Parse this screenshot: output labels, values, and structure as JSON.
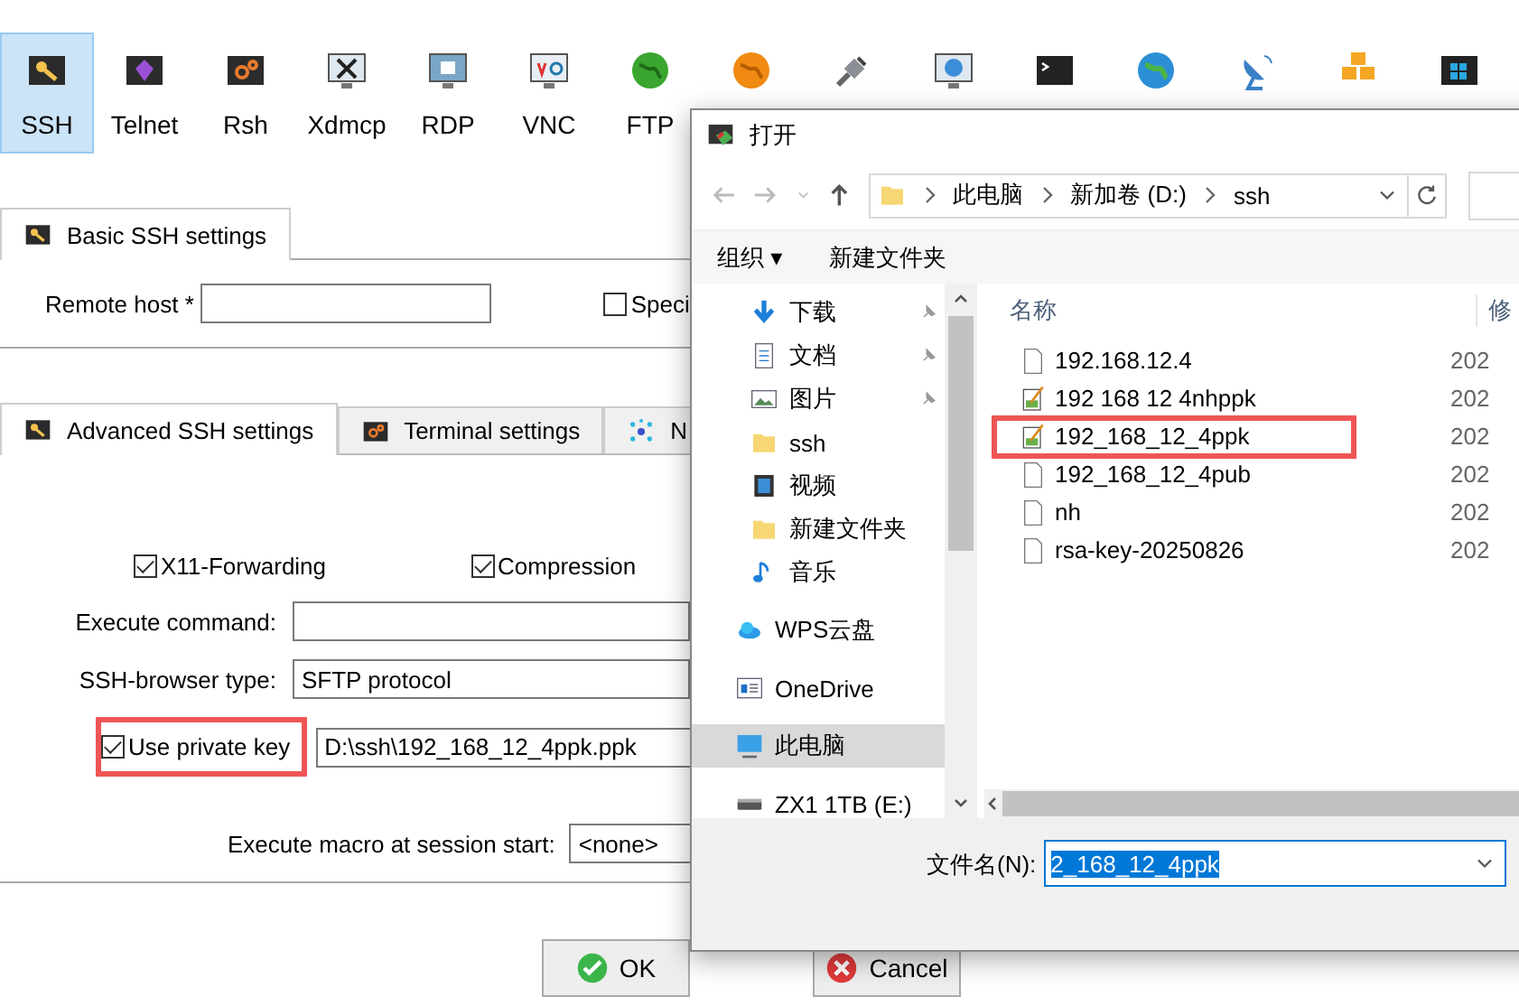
{
  "toolbar": [
    {
      "kind": "key",
      "label": "SSH",
      "selected": true
    },
    {
      "kind": "gem",
      "label": "Telnet",
      "selected": false
    },
    {
      "kind": "gears",
      "label": "Rsh",
      "selected": false
    },
    {
      "kind": "xwin",
      "label": "Xdmcp",
      "selected": false
    },
    {
      "kind": "rdp",
      "label": "RDP",
      "selected": false
    },
    {
      "kind": "vnc",
      "label": "VNC",
      "selected": false
    },
    {
      "kind": "globe-green",
      "label": "FTP",
      "selected": false
    },
    {
      "kind": "globe-orange",
      "selected": false
    },
    {
      "kind": "plug",
      "selected": false
    },
    {
      "kind": "monitor-globe",
      "selected": false
    },
    {
      "kind": "terminal",
      "selected": false
    },
    {
      "kind": "globe-blue",
      "selected": false
    },
    {
      "kind": "dish",
      "selected": false
    },
    {
      "kind": "cubes",
      "selected": false
    },
    {
      "kind": "windows",
      "selected": false
    }
  ],
  "basic_tab": {
    "label": "Basic SSH settings",
    "selected": true
  },
  "remote_host": {
    "label": "Remote host *"
  },
  "specify_checkbox": {
    "label": "Speci",
    "checked": false
  },
  "advanced_tabs": [
    {
      "kind": "key",
      "label": "Advanced SSH settings",
      "selected": true
    },
    {
      "kind": "gears",
      "label": "Terminal settings",
      "selected": false
    },
    {
      "kind": "network",
      "label": "N",
      "selected": false
    }
  ],
  "x11_forwarding": {
    "label": "X11-Forwarding",
    "checked": true
  },
  "compression": {
    "label": "Compression",
    "checked": true
  },
  "execute_command": {
    "label": "Execute command:"
  },
  "ssh_browser_type": {
    "label": "SSH-browser type:",
    "value": "SFTP protocol"
  },
  "use_private_key": {
    "label": "Use private key",
    "checked": true,
    "highlighted": true,
    "value": "D:\\ssh\\192_168_12_4ppk.ppk"
  },
  "execute_macro": {
    "label": "Execute macro at session start:",
    "value": "<none>"
  },
  "buttons": [
    {
      "kind": "ok",
      "label": "OK"
    },
    {
      "kind": "cancel",
      "label": "Cancel"
    }
  ],
  "dialog": {
    "title": "打开",
    "path": [
      "此电脑",
      "新加卷 (D:)",
      "ssh"
    ],
    "toolbar": [
      "组织 ▾",
      "新建文件夹"
    ],
    "quick_access": [
      {
        "kind": "download",
        "label": "下载",
        "pinned": true
      },
      {
        "kind": "document",
        "label": "文档",
        "pinned": true
      },
      {
        "kind": "picture",
        "label": "图片",
        "pinned": true
      },
      {
        "kind": "folder",
        "label": "ssh",
        "pinned": false
      },
      {
        "kind": "video",
        "label": "视频",
        "pinned": false
      },
      {
        "kind": "folder",
        "label": "新建文件夹",
        "pinned": false
      },
      {
        "kind": "music",
        "label": "音乐",
        "pinned": false
      }
    ],
    "locations": [
      {
        "kind": "cloud",
        "label": "WPS云盘",
        "selected": false
      },
      {
        "kind": "onedrive",
        "label": "OneDrive",
        "selected": false
      },
      {
        "kind": "pc",
        "label": "此电脑",
        "selected": true
      },
      {
        "kind": "drive",
        "label": "ZX1 1TB (E:)",
        "selected": false
      }
    ],
    "columns": [
      "名称",
      "修"
    ],
    "files": [
      {
        "kind": "blank",
        "name": "192.168.12.4",
        "date": "202",
        "highlighted": false
      },
      {
        "kind": "note",
        "name": "192 168 12 4nhppk",
        "date": "202",
        "highlighted": false
      },
      {
        "kind": "note",
        "name": "192_168_12_4ppk",
        "date": "202",
        "highlighted": true
      },
      {
        "kind": "blank",
        "name": "192_168_12_4pub",
        "date": "202",
        "highlighted": false
      },
      {
        "kind": "blank",
        "name": "nh",
        "date": "202",
        "highlighted": false
      },
      {
        "kind": "blank",
        "name": "rsa-key-20250826",
        "date": "202",
        "highlighted": false
      }
    ],
    "filename": {
      "label": "文件名(N):",
      "value": "2_168_12_4ppk"
    }
  }
}
